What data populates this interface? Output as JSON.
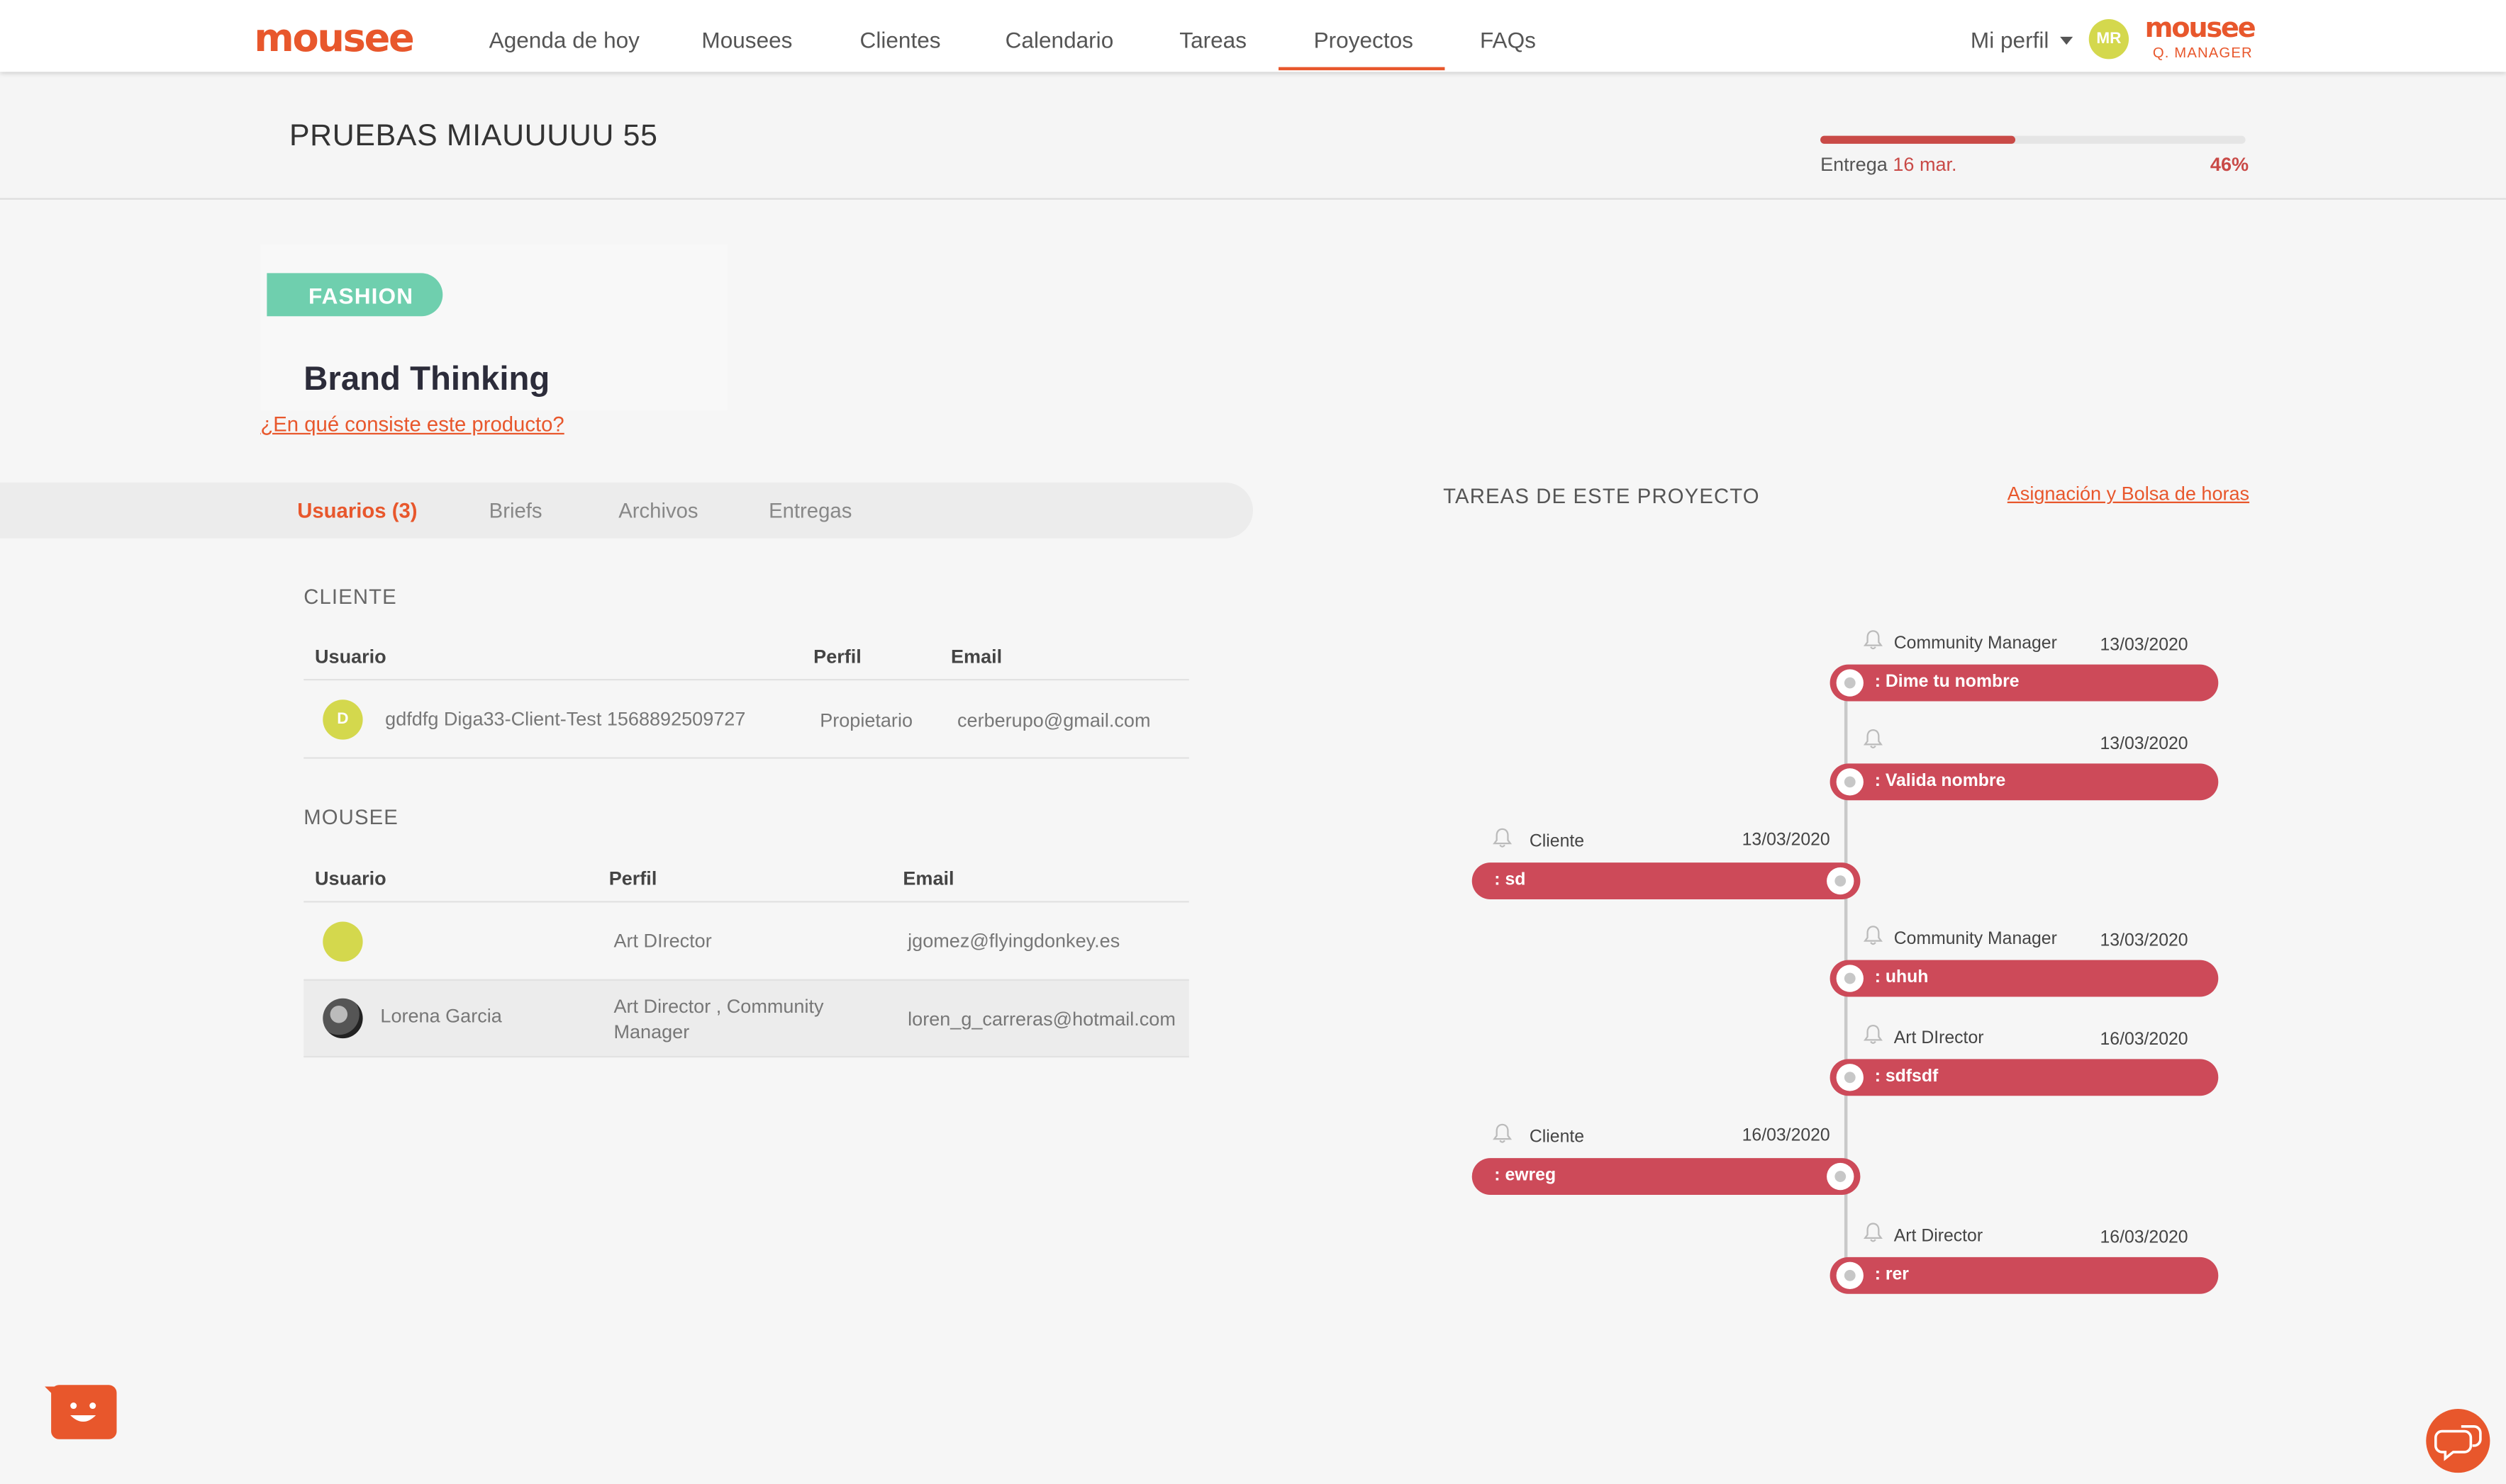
{
  "brand": {
    "logo": "mousee",
    "logo_small": "mousee",
    "logo_sub": "Q. MANAGER",
    "accent": "#e8572c"
  },
  "nav": {
    "items": [
      "Agenda de hoy",
      "Mousees",
      "Clientes",
      "Calendario",
      "Tareas",
      "Proyectos",
      "FAQs"
    ],
    "active": "Proyectos",
    "profile_label": "Mi perfil",
    "avatar_initials": "MR"
  },
  "project": {
    "title": "PRUEBAS MIAUUUUU 55",
    "delivery_label": "Entrega",
    "delivery_date": "16 mar.",
    "progress_percent": "46%",
    "progress_value": 0.46
  },
  "product": {
    "category": "FASHION",
    "name": "Brand Thinking",
    "info_link": "¿En qué consiste este producto?"
  },
  "tabs": [
    "Usuarios (3)",
    "Briefs",
    "Archivos",
    "Entregas"
  ],
  "client_section": {
    "title": "CLIENTE",
    "headers": [
      "Usuario",
      "Perfil",
      "Email"
    ],
    "rows": [
      {
        "initial": "D",
        "name": "gdfdfg Diga33-Client-Test 1568892509727",
        "profile": "Propietario",
        "email": "cerberupo@gmail.com"
      }
    ]
  },
  "mousee_section": {
    "title": "MOUSEE",
    "headers": [
      "Usuario",
      "Perfil",
      "Email"
    ],
    "rows": [
      {
        "name": "",
        "profile": "Art DIrector",
        "email": "jgomez@flyingdonkey.es"
      },
      {
        "name": "Lorena Garcia",
        "profile_line1": "Art Director , Community",
        "profile_line2": "Manager",
        "email": "loren_g_carreras@hotmail.com"
      }
    ]
  },
  "tasks": {
    "title": "TAREAS DE ESTE PROYECTO",
    "link": "Asignación y Bolsa de horas",
    "items": [
      {
        "role": "Community Manager",
        "date": "13/03/2020",
        "label": ": Dime tu nombre",
        "side": "right"
      },
      {
        "role": "",
        "date": "13/03/2020",
        "label": ": Valida nombre",
        "side": "right"
      },
      {
        "role": "Cliente",
        "date": "13/03/2020",
        "label": ": sd",
        "side": "left"
      },
      {
        "role": "Community Manager",
        "date": "13/03/2020",
        "label": ": uhuh",
        "side": "right"
      },
      {
        "role": "Art DIrector",
        "date": "16/03/2020",
        "label": ": sdfsdf",
        "side": "right"
      },
      {
        "role": "Cliente",
        "date": "16/03/2020",
        "label": ": ewreg",
        "side": "left"
      },
      {
        "role": "Art Director",
        "date": "16/03/2020",
        "label": ": rer",
        "side": "right"
      }
    ]
  }
}
